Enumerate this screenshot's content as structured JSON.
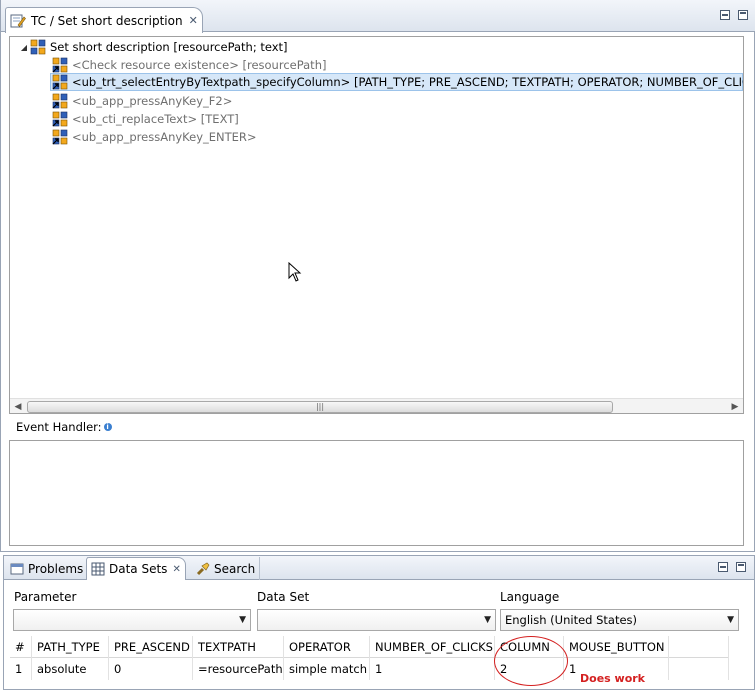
{
  "editor": {
    "tab_title": "TC / Set short description",
    "tree": {
      "root_label": "Set short description [resourcePath; text]",
      "children": [
        {
          "label": "<Check resource existence> [resourcePath]",
          "style": "grey"
        },
        {
          "label": "<ub_trt_selectEntryByTextpath_specifyColumn> [PATH_TYPE; PRE_ASCEND; TEXTPATH; OPERATOR; NUMBER_OF_CLICKS; CO",
          "style": "selected"
        },
        {
          "label": "<ub_app_pressAnyKey_F2>",
          "style": "grey"
        },
        {
          "label": "<ub_cti_replaceText> [TEXT]",
          "style": "grey"
        },
        {
          "label": "<ub_app_pressAnyKey_ENTER>",
          "style": "grey"
        }
      ]
    },
    "scroll_grip": "|||",
    "event_handler_label": "Event Handler:",
    "info_glyph": "i"
  },
  "views": {
    "tabs": [
      {
        "label": "Problems",
        "icon": "problems-icon"
      },
      {
        "label": "Data Sets",
        "icon": "data-sets-icon"
      },
      {
        "label": "Search",
        "icon": "search-flashlight-icon"
      }
    ],
    "parameter_label": "Parameter",
    "parameter_value": "",
    "dataset_label": "Data Set",
    "dataset_value": "",
    "language_label": "Language",
    "language_value": "English (United States)",
    "grid": {
      "columns": [
        "#",
        "PATH_TYPE",
        "PRE_ASCEND",
        "TEXTPATH",
        "OPERATOR",
        "NUMBER_OF_CLICKS",
        "COLUMN",
        "MOUSE_BUTTON",
        ""
      ],
      "rows": [
        [
          "1",
          "absolute",
          "0",
          "=resourcePath",
          "simple match",
          "1",
          "2",
          "1",
          ""
        ]
      ]
    }
  },
  "annotation": "Does work",
  "colors": {
    "selection": "#d6e7f8",
    "annotation_red": "#d42020"
  }
}
